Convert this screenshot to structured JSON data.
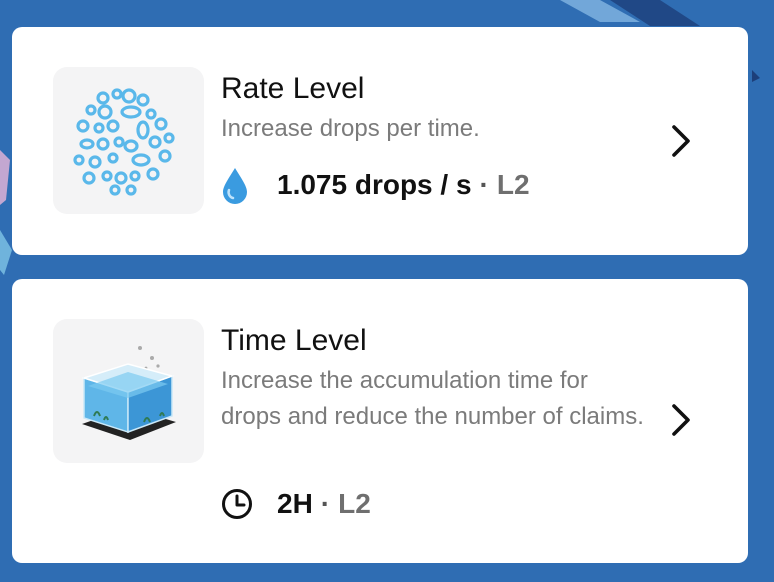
{
  "colors": {
    "background": "#2f6db3",
    "card": "#ffffff",
    "accent_drop": "#3a9be0",
    "title": "#111111",
    "description": "#7b7b7b",
    "level": "#6f6f6f"
  },
  "upgrades": [
    {
      "title": "Rate Level",
      "description": "Increase drops per time.",
      "value": "1.075 drops / s",
      "separator": "·",
      "level": "L2",
      "stat_icon": "water-drop-icon",
      "thumbnail": "bubbles-illustration",
      "action_icon": "chevron-right-icon"
    },
    {
      "title": "Time Level",
      "description": "Increase the accumulation time for drops and reduce the number of claims.",
      "value": "2H",
      "separator": "·",
      "level": "L2",
      "stat_icon": "clock-icon",
      "thumbnail": "water-tank-illustration",
      "action_icon": "chevron-right-icon"
    }
  ]
}
